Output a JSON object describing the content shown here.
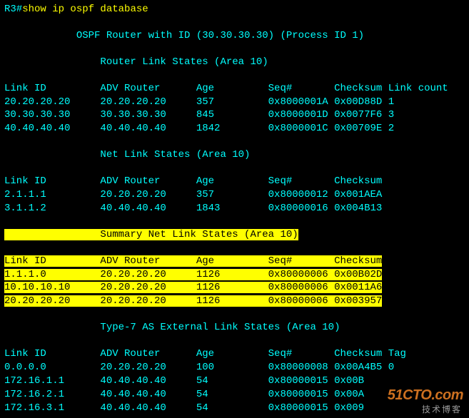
{
  "prompt": "R3#",
  "command": "show ip ospf database",
  "header_line": "            OSPF Router with ID (30.30.30.30) (Process ID 1)",
  "sections": {
    "router": {
      "title": "                Router Link States (Area 10)",
      "head": "Link ID         ADV Router      Age         Seq#       Checksum Link count",
      "rows": [
        "20.20.20.20     20.20.20.20     357         0x8000001A 0x00D88D 1",
        "30.30.30.30     30.30.30.30     845         0x8000001D 0x0077F6 3",
        "40.40.40.40     40.40.40.40     1842        0x8000001C 0x00709E 2"
      ]
    },
    "net": {
      "title": "                Net Link States (Area 10)",
      "head": "Link ID         ADV Router      Age         Seq#       Checksum",
      "rows": [
        "2.1.1.1         20.20.20.20     357         0x80000012 0x001AEA",
        "3.1.1.2         40.40.40.40     1843        0x80000016 0x004B13"
      ]
    },
    "summary": {
      "title": "                Summary Net Link States (Area 10)",
      "head": "Link ID         ADV Router      Age         Seq#       Checksum",
      "rows": [
        "1.1.1.0         20.20.20.20     1126        0x80000006 0x00B02D",
        "10.10.10.10     20.20.20.20     1126        0x80000006 0x0011A6",
        "20.20.20.20     20.20.20.20     1126        0x80000006 0x003957"
      ]
    },
    "type7": {
      "title": "                Type-7 AS External Link States (Area 10)",
      "head": "Link ID         ADV Router      Age         Seq#       Checksum Tag",
      "rows": [
        "0.0.0.0         20.20.20.20     100         0x80000008 0x00A4B5 0",
        "172.16.1.1      40.40.40.40     54          0x80000015 0x00B",
        "172.16.2.1      40.40.40.40     54          0x80000015 0x00A",
        "172.16.3.1      40.40.40.40     54          0x80000015 0x009"
      ]
    }
  },
  "watermark1": "51CTO.com",
  "watermark2": "技术博客"
}
